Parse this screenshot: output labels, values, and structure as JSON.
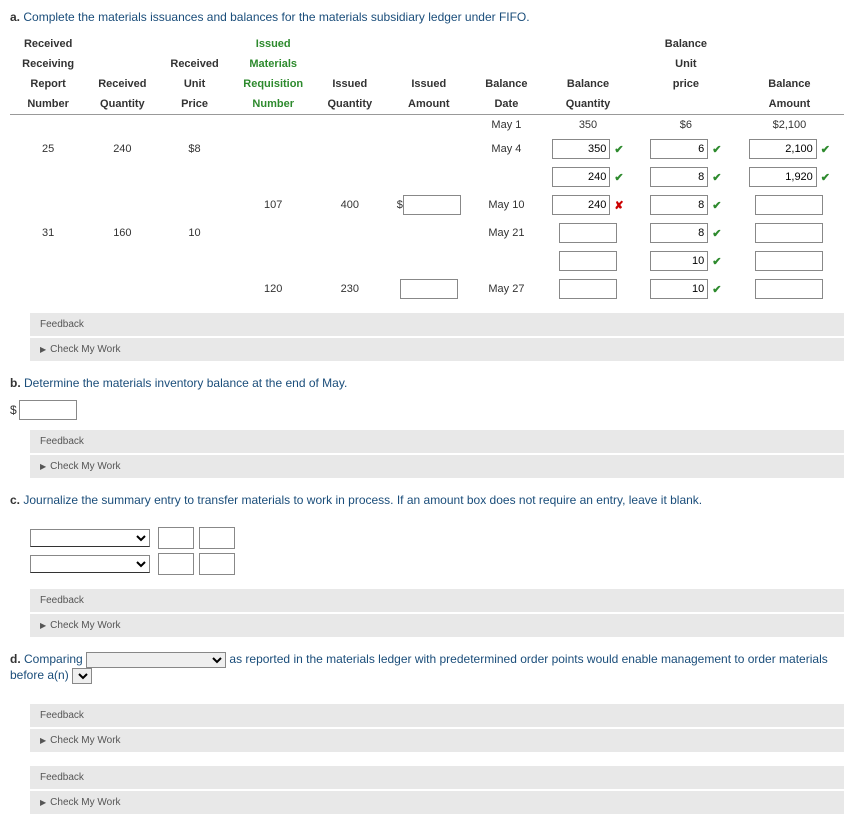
{
  "a": {
    "label": "a.",
    "prompt": "Complete the materials issuances and balances for the materials subsidiary ledger under FIFO.",
    "headers": {
      "c1a": "Received",
      "c1b": "Receiving",
      "c1c": "Report",
      "c1d": "Number",
      "c2a": "Received",
      "c2b": "Quantity",
      "c3a": "Received",
      "c3b": "Unit",
      "c3c": "Price",
      "c4a": "Issued",
      "c4b": "Materials",
      "c4c": "Requisition",
      "c4d": "Number",
      "c5a": "Issued",
      "c5b": "Quantity",
      "c6a": "Issued",
      "c6b": "Amount",
      "c7a": "Balance",
      "c7b": "Date",
      "c8a": "Balance",
      "c8b": "Quantity",
      "c9a": "Balance",
      "c9b": "Unit",
      "c9c": "price",
      "c10a": "Balance",
      "c10b": "Amount"
    },
    "rows": [
      {
        "date": "May 1",
        "bq": "350",
        "bp": "$6",
        "ba": "$2,100"
      },
      {
        "rn": "25",
        "rq": "240",
        "rp": "$8",
        "date": "May 4",
        "bq_in": "350",
        "bq_mark": "check",
        "bp_in": "6",
        "bp_mark": "check",
        "ba_in": "2,100",
        "ba_mark": "check"
      },
      {
        "bq_in": "240",
        "bq_mark": "check",
        "bp_in": "8",
        "bp_mark": "check",
        "ba_in": "1,920",
        "ba_mark": "check"
      },
      {
        "mr": "107",
        "iq": "400",
        "ia_in": "",
        "ia_dollar": true,
        "date": "May 10",
        "bq_in": "240",
        "bq_mark": "x",
        "bp_in": "8",
        "bp_mark": "check",
        "ba_in": "",
        "ba_mark": ""
      },
      {
        "rn": "31",
        "rq": "160",
        "rp": "10",
        "date": "May 21",
        "bq_in": "",
        "bp_in": "8",
        "bp_mark": "check",
        "ba_in": ""
      },
      {
        "bq_in": "",
        "bp_in": "10",
        "bp_mark": "check",
        "ba_in": ""
      },
      {
        "mr": "120",
        "iq": "230",
        "ia_in": "",
        "date": "May 27",
        "bq_in": "",
        "bp_in": "10",
        "bp_mark": "check",
        "ba_in": ""
      }
    ]
  },
  "b": {
    "label": "b.",
    "prompt": "Determine the materials inventory balance at the end of May.",
    "dollar": "$"
  },
  "c": {
    "label": "c.",
    "prompt": "Journalize the summary entry to transfer materials to work in process. If an amount box does not require an entry, leave it blank."
  },
  "d": {
    "label": "d.",
    "prompt1": "Comparing",
    "prompt2": "as reported in the materials ledger with predetermined order points would enable management to order materials before a(n)"
  },
  "feedback": "Feedback",
  "check_my_work": "Check My Work"
}
